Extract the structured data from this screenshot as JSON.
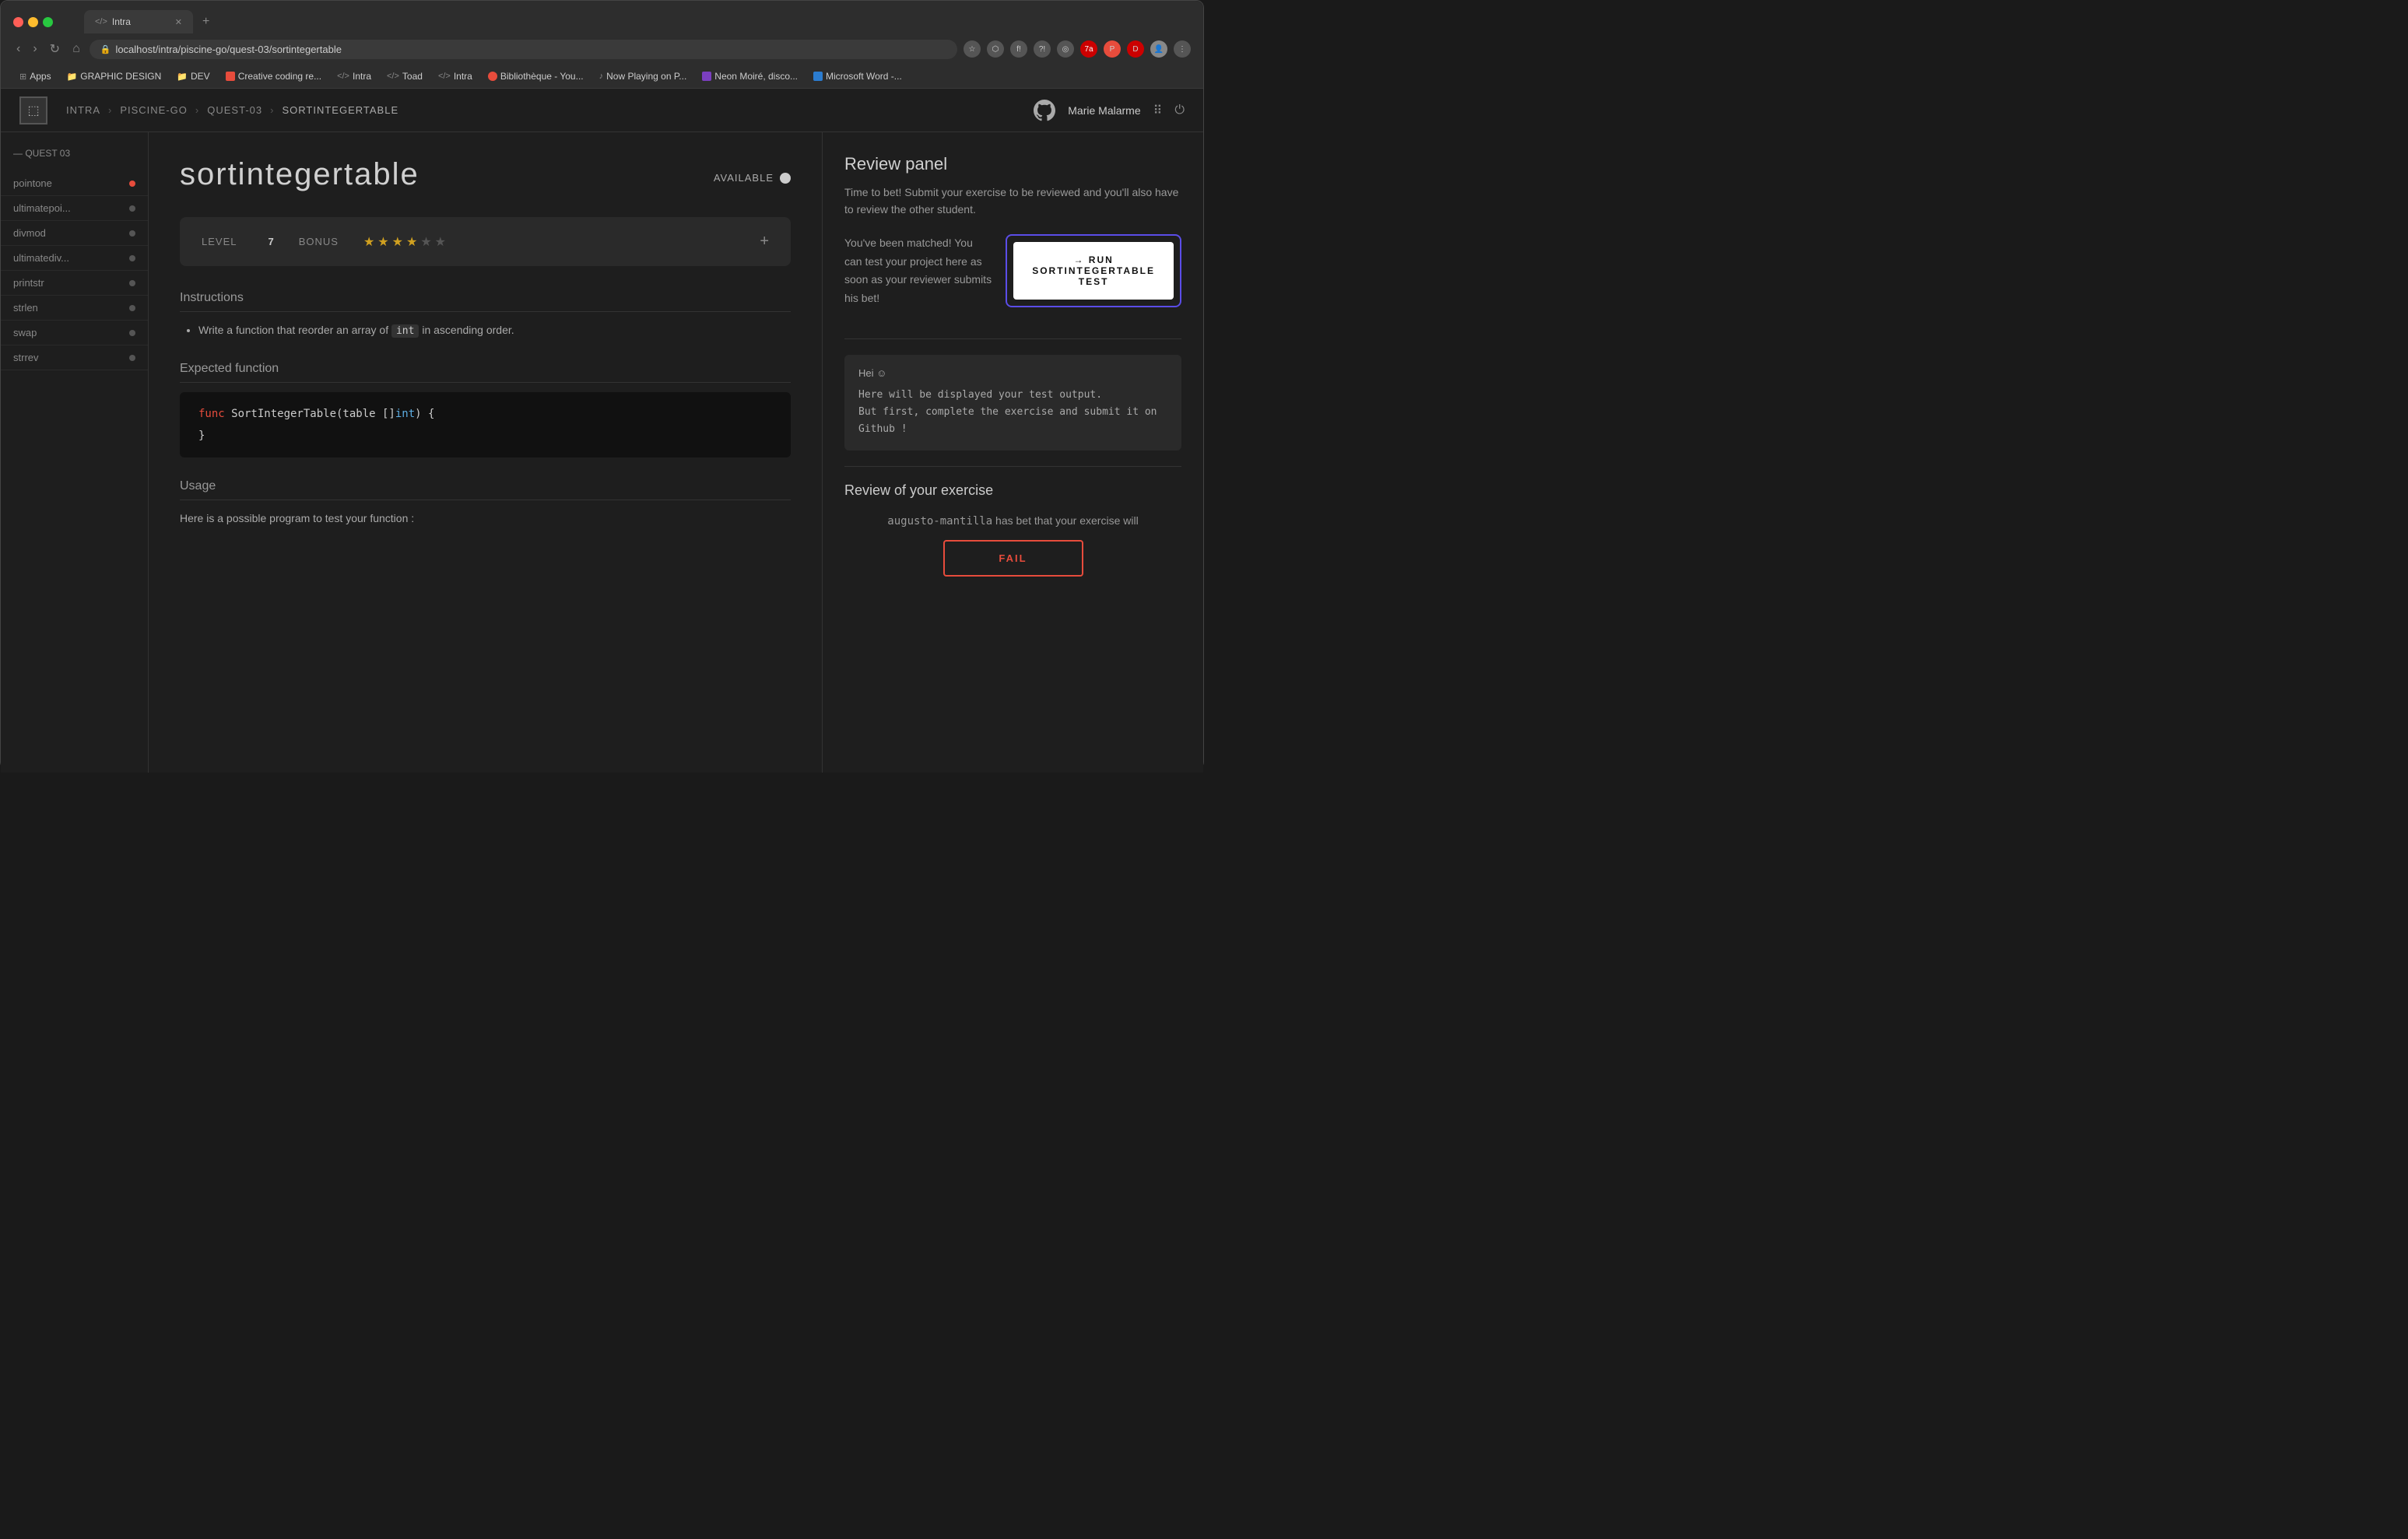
{
  "browser": {
    "tab_label": "Intra",
    "tab_icon": "</>",
    "url": "localhost/intra/piscine-go/quest-03/sortintegertable",
    "bookmarks": [
      {
        "label": "Apps",
        "icon": "grid",
        "color": null
      },
      {
        "label": "GRAPHIC DESIGN",
        "icon": "folder",
        "color": null
      },
      {
        "label": "DEV",
        "icon": "folder",
        "color": null
      },
      {
        "label": "Creative coding re...",
        "icon": "dot",
        "color": "#e74c3c"
      },
      {
        "label": "Intra",
        "icon": "</>",
        "color": null
      },
      {
        "label": "Toad",
        "icon": "</>",
        "color": null
      },
      {
        "label": "Intra",
        "icon": "</>",
        "color": null
      },
      {
        "label": "Bibliothèque - You...",
        "icon": "yt",
        "color": "#e74c3c"
      },
      {
        "label": "Now Playing on P...",
        "icon": "music",
        "color": null
      },
      {
        "label": "Neon Moiré, disco...",
        "icon": "neon",
        "color": null
      },
      {
        "label": "Microsoft Word -...",
        "icon": "word",
        "color": null
      }
    ]
  },
  "app": {
    "logo": "⬚",
    "breadcrumbs": [
      "INTRA",
      "PISCINE-GO",
      "QUEST-03",
      "SORTINTEGERTABLE"
    ],
    "username": "Marie Malarme"
  },
  "sidebar": {
    "section_title": "— QUEST 03",
    "items": [
      {
        "label": "pointone",
        "dot_class": "dot-red"
      },
      {
        "label": "ultimatepoi...",
        "dot_class": "dot-gray"
      },
      {
        "label": "divmod",
        "dot_class": "dot-gray"
      },
      {
        "label": "ultimatediv...",
        "dot_class": "dot-gray"
      },
      {
        "label": "printstr",
        "dot_class": "dot-gray"
      },
      {
        "label": "strlen",
        "dot_class": "dot-gray"
      },
      {
        "label": "swap",
        "dot_class": "dot-gray"
      },
      {
        "label": "strrev",
        "dot_class": "dot-gray"
      }
    ]
  },
  "exercise": {
    "title": "sortintegertable",
    "status": "AVAILABLE",
    "level_label": "LEVEL",
    "level_num": "7",
    "bonus_label": "BONUS",
    "stars_filled": 4,
    "stars_total": 6,
    "instructions_title": "Instructions",
    "instruction_text_before": "Write a function that reorder an array of ",
    "instruction_code": "int",
    "instruction_text_after": " in ascending order.",
    "expected_fn_title": "Expected function",
    "code_line1_kw": "func",
    "code_line1_name": " SortIntegerTable(table []",
    "code_line1_type": "int",
    "code_line1_end": ") {",
    "code_line2": "}",
    "usage_title": "Usage",
    "usage_desc": "Here is a possible program to test your function :"
  },
  "review_panel": {
    "title": "Review panel",
    "description": "Time to bet! Submit your exercise to be reviewed and you'll also have to review the other student.",
    "matched_text": "You've been matched! You can test your project here as soon as your reviewer submits his bet!",
    "run_btn_label": "→  RUN SORTINTEGERTABLE TEST",
    "terminal_header": "Hei ☺",
    "terminal_line1": "Here will be displayed your test output.",
    "terminal_line2": "But first, complete the exercise and submit it on Github !",
    "review_section_title": "Review of your exercise",
    "reviewer_name": "augusto-mantilla",
    "reviewer_text_after": " has bet that your exercise will",
    "fail_btn_label": "FAIL"
  }
}
